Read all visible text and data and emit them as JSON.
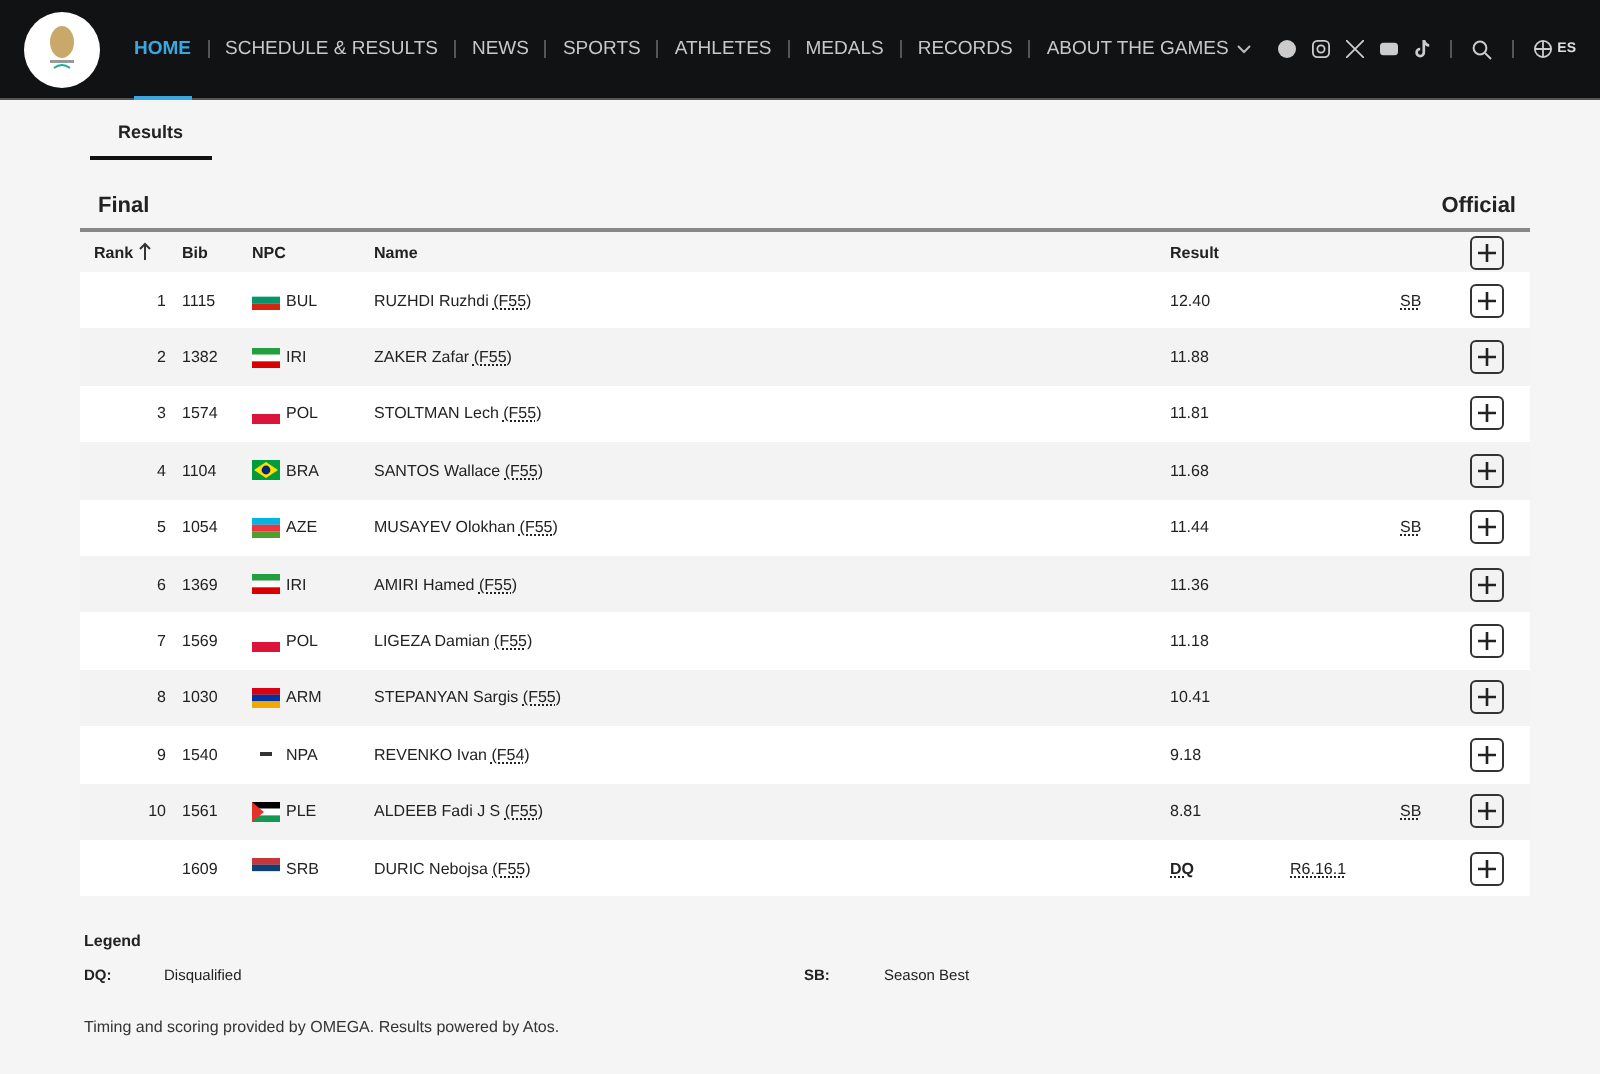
{
  "nav": {
    "items": [
      {
        "label": "HOME",
        "selected": true,
        "dropdown": false
      },
      {
        "label": "SCHEDULE & RESULTS",
        "selected": false,
        "dropdown": false
      },
      {
        "label": "NEWS",
        "selected": false,
        "dropdown": false
      },
      {
        "label": "SPORTS",
        "selected": false,
        "dropdown": false
      },
      {
        "label": "ATHLETES",
        "selected": false,
        "dropdown": false
      },
      {
        "label": "MEDALS",
        "selected": false,
        "dropdown": false
      },
      {
        "label": "RECORDS",
        "selected": false,
        "dropdown": false
      },
      {
        "label": "ABOUT THE GAMES",
        "selected": false,
        "dropdown": true
      }
    ],
    "language": "ES"
  },
  "tabs": [
    {
      "label": "Results",
      "selected": true
    }
  ],
  "heading": {
    "title": "Final",
    "status": "Official"
  },
  "table": {
    "columns": [
      "Rank",
      "Bib",
      "NPC",
      "Name",
      "Result"
    ],
    "rows": [
      {
        "rank": "1",
        "bib": "1115",
        "npc": "BUL",
        "flag": {
          "kind": "bulgaria"
        },
        "name": "RUZHDI Ruzhdi",
        "class": "(F55)",
        "result": "12.40",
        "status": false,
        "record": "SB"
      },
      {
        "rank": "2",
        "bib": "1382",
        "npc": "IRI",
        "flag": {
          "kind": "iran"
        },
        "name": "ZAKER Zafar",
        "class": "(F55)",
        "result": "11.88",
        "status": false
      },
      {
        "rank": "3",
        "bib": "1574",
        "npc": "POL",
        "flag": {
          "kind": "poland"
        },
        "name": "STOLTMAN Lech",
        "class": "(F55)",
        "result": "11.81",
        "status": false
      },
      {
        "rank": "4",
        "bib": "1104",
        "npc": "BRA",
        "flag": {
          "kind": "brazil"
        },
        "name": "SANTOS Wallace",
        "class": "(F55)",
        "result": "11.68",
        "status": false
      },
      {
        "rank": "5",
        "bib": "1054",
        "npc": "AZE",
        "flag": {
          "kind": "azerbaijan"
        },
        "name": "MUSAYEV Olokhan",
        "class": "(F55)",
        "result": "11.44",
        "status": false,
        "record": "SB"
      },
      {
        "rank": "6",
        "bib": "1369",
        "npc": "IRI",
        "flag": {
          "kind": "iran"
        },
        "name": "AMIRI Hamed",
        "class": "(F55)",
        "result": "11.36",
        "status": false
      },
      {
        "rank": "7",
        "bib": "1569",
        "npc": "POL",
        "flag": {
          "kind": "poland"
        },
        "name": "LIGEZA Damian",
        "class": "(F55)",
        "result": "11.18",
        "status": false
      },
      {
        "rank": "8",
        "bib": "1030",
        "npc": "ARM",
        "flag": {
          "kind": "armenia"
        },
        "name": "STEPANYAN Sargis",
        "class": "(F55)",
        "result": "10.41",
        "status": false
      },
      {
        "rank": "9",
        "bib": "1540",
        "npc": "NPA",
        "flag": {
          "kind": "neutral"
        },
        "name": "REVENKO Ivan",
        "class": "(F54)",
        "result": "9.18",
        "status": false
      },
      {
        "rank": "10",
        "bib": "1561",
        "npc": "PLE",
        "flag": {
          "kind": "palestine"
        },
        "name": "ALDEEB Fadi J S",
        "class": "(F55)",
        "result": "8.81",
        "status": false,
        "record": "SB"
      },
      {
        "bib": "1609",
        "npc": "SRB",
        "flag": {
          "kind": "serbia"
        },
        "name": "DURIC Nebojsa",
        "class": "(F55)",
        "result": "DQ",
        "status": true,
        "rule": "R6.16.1"
      }
    ]
  },
  "legend": {
    "title": "Legend",
    "items": [
      {
        "code": "DQ:",
        "text": "Disqualified"
      },
      {
        "code": "SB:",
        "text": "Season Best"
      }
    ]
  },
  "footer": "Timing and scoring provided by OMEGA. Results powered by Atos."
}
